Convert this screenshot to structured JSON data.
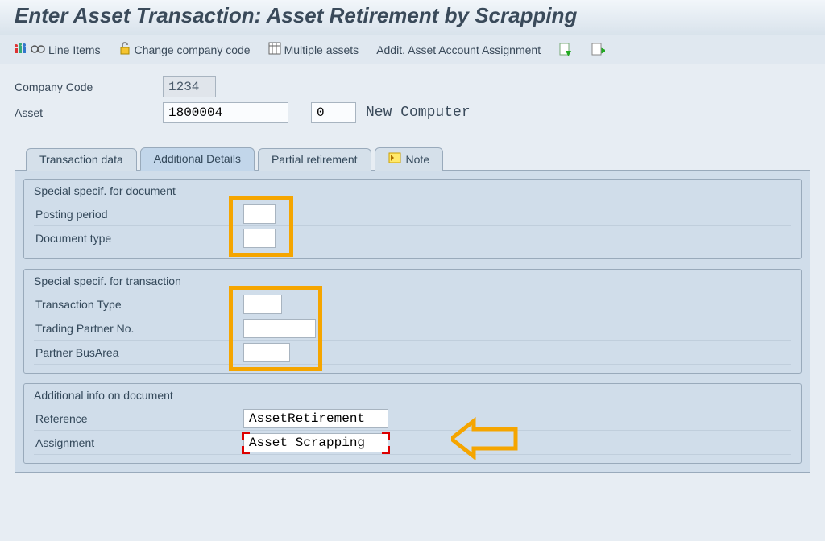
{
  "title": "Enter Asset Transaction: Asset Retirement by Scrapping",
  "toolbar": {
    "line_items": "Line Items",
    "change_company": "Change company code",
    "multiple_assets": "Multiple assets",
    "addit_assign": "Addit. Asset Account Assignment"
  },
  "header": {
    "company_code_label": "Company Code",
    "company_code": "1234",
    "asset_label": "Asset",
    "asset_number": "1800004",
    "asset_sub": "0",
    "asset_desc": "New Computer"
  },
  "tabs": {
    "transaction_data": "Transaction data",
    "additional_details": "Additional Details",
    "partial_retirement": "Partial retirement",
    "note": "Note"
  },
  "groups": {
    "doc": {
      "title": "Special specif. for document",
      "posting_period": "Posting period",
      "document_type": "Document type"
    },
    "txn": {
      "title": "Special specif. for transaction",
      "transaction_type": "Transaction Type",
      "trading_partner": "Trading Partner No.",
      "partner_busarea": "Partner BusArea"
    },
    "info": {
      "title": "Additional info on document",
      "reference_label": "Reference",
      "reference_value": "AssetRetirement",
      "assignment_label": "Assignment",
      "assignment_value": "Asset Scrapping"
    }
  }
}
